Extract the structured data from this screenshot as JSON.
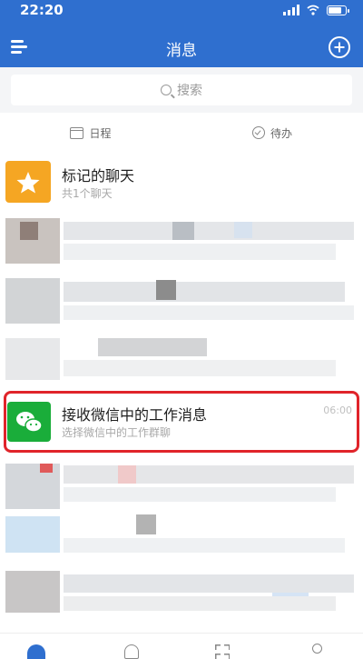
{
  "status_bar": {
    "time": "22:20"
  },
  "header": {
    "title": "消息"
  },
  "search": {
    "placeholder": "搜索"
  },
  "quick_actions": [
    {
      "label": "日程",
      "icon": "calendar-icon"
    },
    {
      "label": "待办",
      "icon": "todo-check-icon"
    }
  ],
  "starred": {
    "title": "标记的聊天",
    "subtitle": "共1个聊天"
  },
  "wechat": {
    "title": "接收微信中的工作消息",
    "subtitle": "选择微信中的工作群聊",
    "time": "06:00"
  },
  "colors": {
    "brand_blue": "#2f6fcf",
    "star_yellow": "#f5a623",
    "wechat_green": "#1aad3a",
    "highlight_red": "#e0242a"
  }
}
